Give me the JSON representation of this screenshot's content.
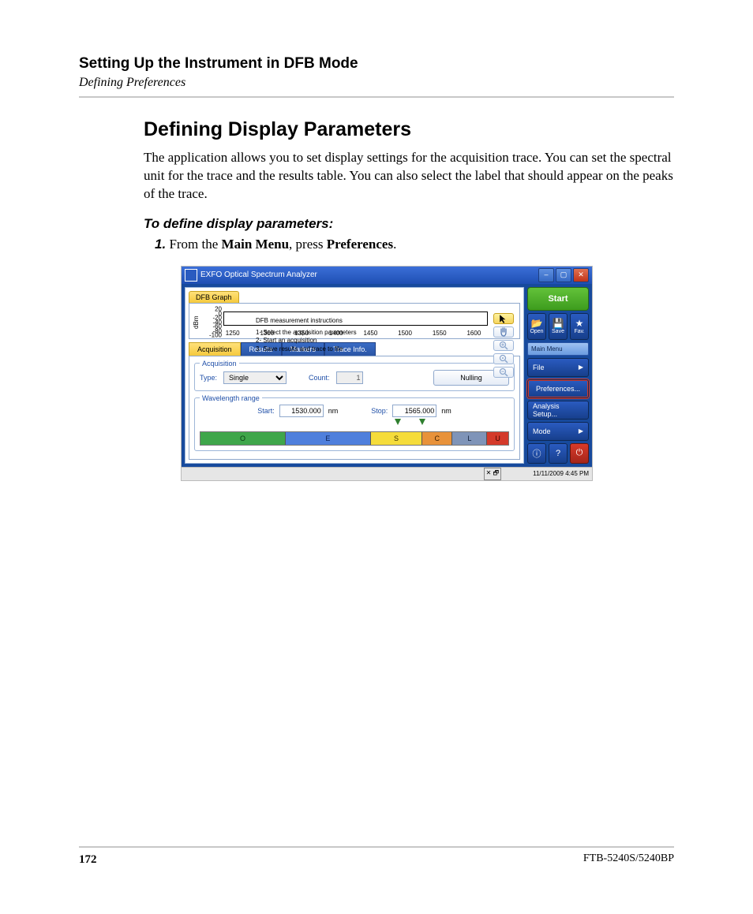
{
  "chapterTitle": "Setting Up the Instrument in DFB Mode",
  "sectionSub": "Defining Preferences",
  "sectionTitle": "Defining Display Parameters",
  "bodyText": "The application allows you to set display settings for the acquisition trace. You can set the spectral unit for the trace and the results table. You can also select the label that should appear on the peaks of the trace.",
  "instrTitle": "To define display parameters:",
  "step1_num": "1.",
  "step1_a": "From the ",
  "step1_b": "Main Menu",
  "step1_c": ", press ",
  "step1_d": "Preferences",
  "step1_e": ".",
  "pageNum": "172",
  "model": "FTB-5240S/5240BP",
  "app": {
    "title": "EXFO Optical Spectrum Analyzer",
    "dfbTab": "DFB Graph",
    "yAxisLabel": "dBm",
    "yTicks": [
      "20",
      "0",
      "-20",
      "-40",
      "-60",
      "-80",
      "-100"
    ],
    "xTicks": [
      "1250",
      "1300",
      "1350",
      "1400",
      "1450",
      "1500",
      "1550",
      "1600"
    ],
    "xUnit": "nm",
    "plotTitle": "DFB measurement instructions",
    "plotL1": "1- Select the acquisition parameters",
    "plotL2": "2- Start an acquisition",
    "plotL3": "3- Save results and trace to file",
    "tabs": {
      "acq": "Acquisition",
      "res": "Results",
      "mrk": "Markers",
      "tri": "Trace Info."
    },
    "acq": {
      "legend": "Acquisition",
      "typeLbl": "Type:",
      "typeVal": "Single",
      "countLbl": "Count:",
      "countVal": "1",
      "nulling": "Nulling"
    },
    "wav": {
      "legend": "Wavelength range",
      "startLbl": "Start:",
      "startVal": "1530.000",
      "stopLbl": "Stop:",
      "stopVal": "1565.000",
      "unit": "nm",
      "bands": {
        "O": "O",
        "E": "E",
        "S": "S",
        "C": "C",
        "L": "L",
        "U": "U"
      }
    },
    "right": {
      "start": "Start",
      "open": "Open",
      "save": "Save",
      "fav": "Fav.",
      "mainMenu": "Main Menu",
      "file": "File",
      "pref": "Preferences...",
      "setup": "Analysis Setup...",
      "mode": "Mode"
    },
    "status": {
      "icons": "✕ 🗗",
      "time": "11/11/2009 4:45 PM"
    }
  }
}
